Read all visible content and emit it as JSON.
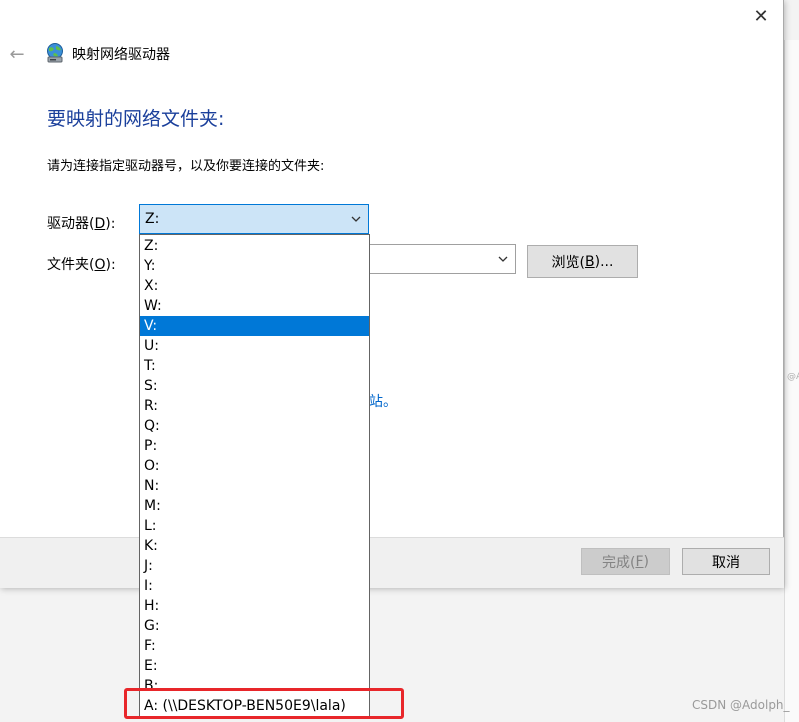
{
  "window": {
    "title": "映射网络驱动器",
    "close_icon": "close-icon",
    "back_icon": "back-arrow-icon"
  },
  "main": {
    "heading": "要映射的网络文件夹:",
    "instruction": "请为连接指定驱动器号，以及你要连接的文件夹:",
    "drive_label_pre": "驱动器(",
    "drive_label_key": "D",
    "drive_label_post": "):",
    "folder_label_pre": "文件夹(",
    "folder_label_key": "O",
    "folder_label_post": "):",
    "drive_value": "Z:",
    "browse_pre": "浏览(",
    "browse_key": "B",
    "browse_post": ")...",
    "link_fragment": "站。"
  },
  "dropdown": {
    "options": [
      "Z:",
      "Y:",
      "X:",
      "W:",
      "V:",
      "U:",
      "T:",
      "S:",
      "R:",
      "Q:",
      "P:",
      "O:",
      "N:",
      "M:",
      "L:",
      "K:",
      "J:",
      "I:",
      "H:",
      "G:",
      "F:",
      "E:",
      "B:",
      "A: (\\\\DESKTOP-BEN50E9\\lala)"
    ],
    "selected_index": 4
  },
  "footer": {
    "finish_pre": "完成(",
    "finish_key": "F",
    "finish_post": ")",
    "cancel_label": "取消"
  },
  "background": {
    "fragment": "@A"
  },
  "watermark": "CSDN @Adolph_",
  "colors": {
    "accent": "#0078d7",
    "heading": "#1a3f9b",
    "highlight": "#e8262a",
    "link": "#0066cc"
  }
}
